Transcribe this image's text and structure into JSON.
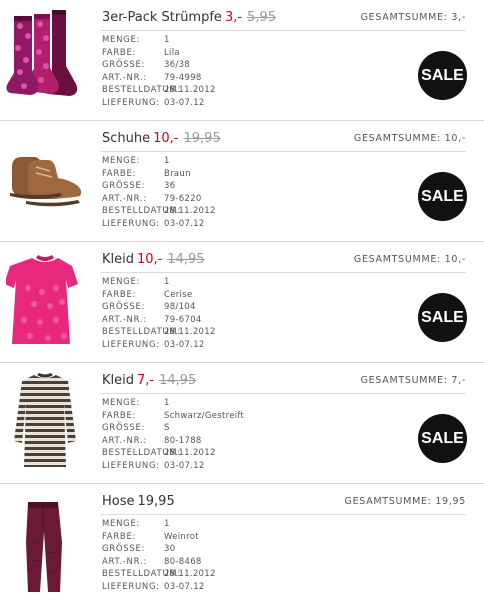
{
  "labels": {
    "menge": "MENGE:",
    "farbe": "FARBE:",
    "groesse": "GRÖSSE:",
    "artnr": "ART.-NR.:",
    "bestelldatum": "BESTELLDATUM:",
    "lieferung": "LIEFERUNG:",
    "sale": "SALE"
  },
  "items": [
    {
      "name": "3er-Pack Strümpfe",
      "price": "3,-",
      "old_price": "5,95",
      "total": "GESAMTSUMME: 3,-",
      "menge": "1",
      "farbe": "Lila",
      "groesse": "36/38",
      "artnr": "79-4998",
      "bestelldatum": "28.11.2012",
      "lieferung": "03-07.12",
      "image_icon": "socks-icon"
    },
    {
      "name": "Schuhe",
      "price": "10,-",
      "old_price": "19,95",
      "total": "GESAMTSUMME: 10,-",
      "menge": "1",
      "farbe": "Braun",
      "groesse": "36",
      "artnr": "79-6220",
      "bestelldatum": "28.11.2012",
      "lieferung": "03-07.12",
      "image_icon": "shoes-icon"
    },
    {
      "name": "Kleid",
      "price": "10,-",
      "old_price": "14,95",
      "total": "GESAMTSUMME: 10,-",
      "menge": "1",
      "farbe": "Cerise",
      "groesse": "98/104",
      "artnr": "79-6704",
      "bestelldatum": "28.11.2012",
      "lieferung": "03-07.12",
      "image_icon": "dress-icon"
    },
    {
      "name": "Kleid",
      "price": "7,-",
      "old_price": "14,95",
      "total": "GESAMTSUMME: 7,-",
      "menge": "1",
      "farbe": "Schwarz/Gestreift",
      "groesse": "S",
      "artnr": "80-1788",
      "bestelldatum": "28.11.2012",
      "lieferung": "03-07.12",
      "image_icon": "striped-dress-icon"
    },
    {
      "name": "Hose",
      "price": "19,95",
      "total": "GESAMTSUMME: 19,95",
      "menge": "1",
      "farbe": "Weinrot",
      "groesse": "30",
      "artnr": "80-8468",
      "bestelldatum": "28.11.2012",
      "lieferung": "03-07.12",
      "image_icon": "trousers-icon"
    }
  ],
  "colors": {
    "sale_price": "#d0021b",
    "old_price": "#9a9a9a",
    "badge_bg": "#111111",
    "separator": "#d6d6d6"
  }
}
